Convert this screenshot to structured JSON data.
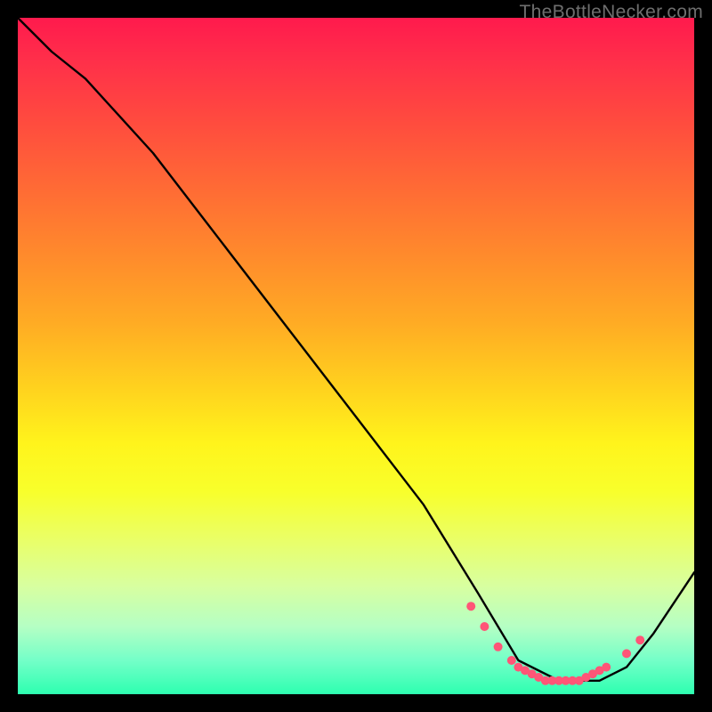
{
  "watermark": "TheBottleNecker.com",
  "chart_data": {
    "type": "line",
    "title": "",
    "xlabel": "",
    "ylabel": "",
    "xlim": [
      0,
      100
    ],
    "ylim": [
      0,
      100
    ],
    "grid": false,
    "series": [
      {
        "name": "bottleneck-curve",
        "x": [
          0,
          5,
          10,
          20,
          30,
          40,
          50,
          60,
          68,
          74,
          80,
          86,
          90,
          94,
          100
        ],
        "y": [
          100,
          95,
          91,
          80,
          67,
          54,
          41,
          28,
          15,
          5,
          2,
          2,
          4,
          9,
          18
        ]
      }
    ],
    "markers": {
      "name": "valley-dots",
      "x": [
        67,
        69,
        71,
        73,
        74,
        75,
        76,
        77,
        78,
        79,
        80,
        81,
        82,
        83,
        84,
        85,
        86,
        87,
        90,
        92
      ],
      "y": [
        13,
        10,
        7,
        5,
        4,
        3.5,
        3,
        2.5,
        2,
        2,
        2,
        2,
        2,
        2,
        2.5,
        3,
        3.5,
        4,
        6,
        8
      ],
      "color": "#ff5577",
      "radius": 5
    },
    "background_gradient": {
      "stops": [
        {
          "pct": 0,
          "color": "#ff1a4d"
        },
        {
          "pct": 15,
          "color": "#ff4a3f"
        },
        {
          "pct": 35,
          "color": "#ff8a2c"
        },
        {
          "pct": 55,
          "color": "#ffd31e"
        },
        {
          "pct": 70,
          "color": "#eaff66"
        },
        {
          "pct": 90,
          "color": "#b5ffc4"
        },
        {
          "pct": 100,
          "color": "#2dffb0"
        }
      ]
    }
  }
}
